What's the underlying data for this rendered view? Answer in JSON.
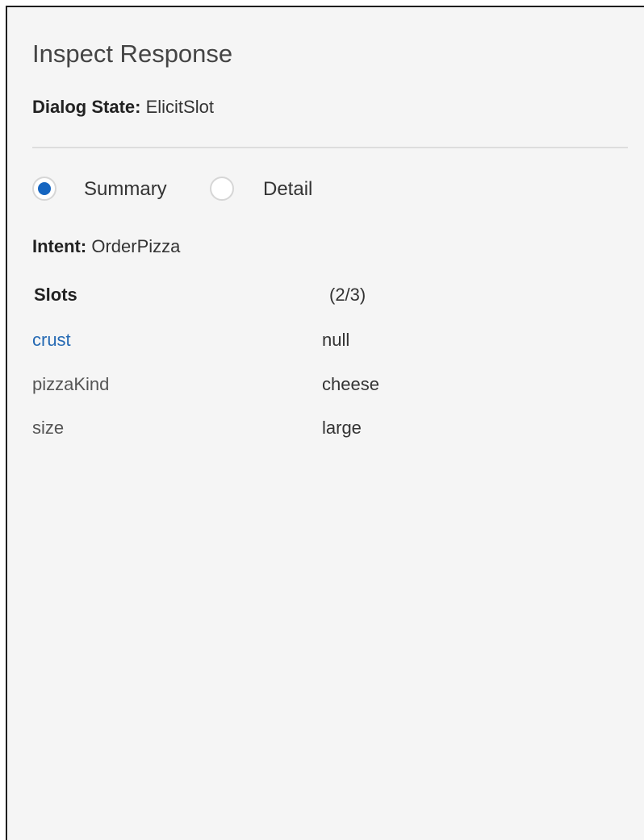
{
  "panel": {
    "title": "Inspect Response",
    "dialog_state_label": "Dialog State:",
    "dialog_state_value": "ElicitSlot"
  },
  "view_mode": {
    "options": [
      {
        "label": "Summary",
        "checked": true
      },
      {
        "label": "Detail",
        "checked": false
      }
    ]
  },
  "intent": {
    "label": "Intent:",
    "value": "OrderPizza"
  },
  "slots": {
    "header": "Slots",
    "count": "(2/3)",
    "rows": [
      {
        "name": "crust",
        "value": "null",
        "highlighted": true
      },
      {
        "name": "pizzaKind",
        "value": "cheese",
        "highlighted": false
      },
      {
        "name": "size",
        "value": "large",
        "highlighted": false
      }
    ]
  },
  "colors": {
    "panel_background": "#f5f5f5",
    "radio_selected": "#1565c0",
    "link": "#2469b3"
  }
}
